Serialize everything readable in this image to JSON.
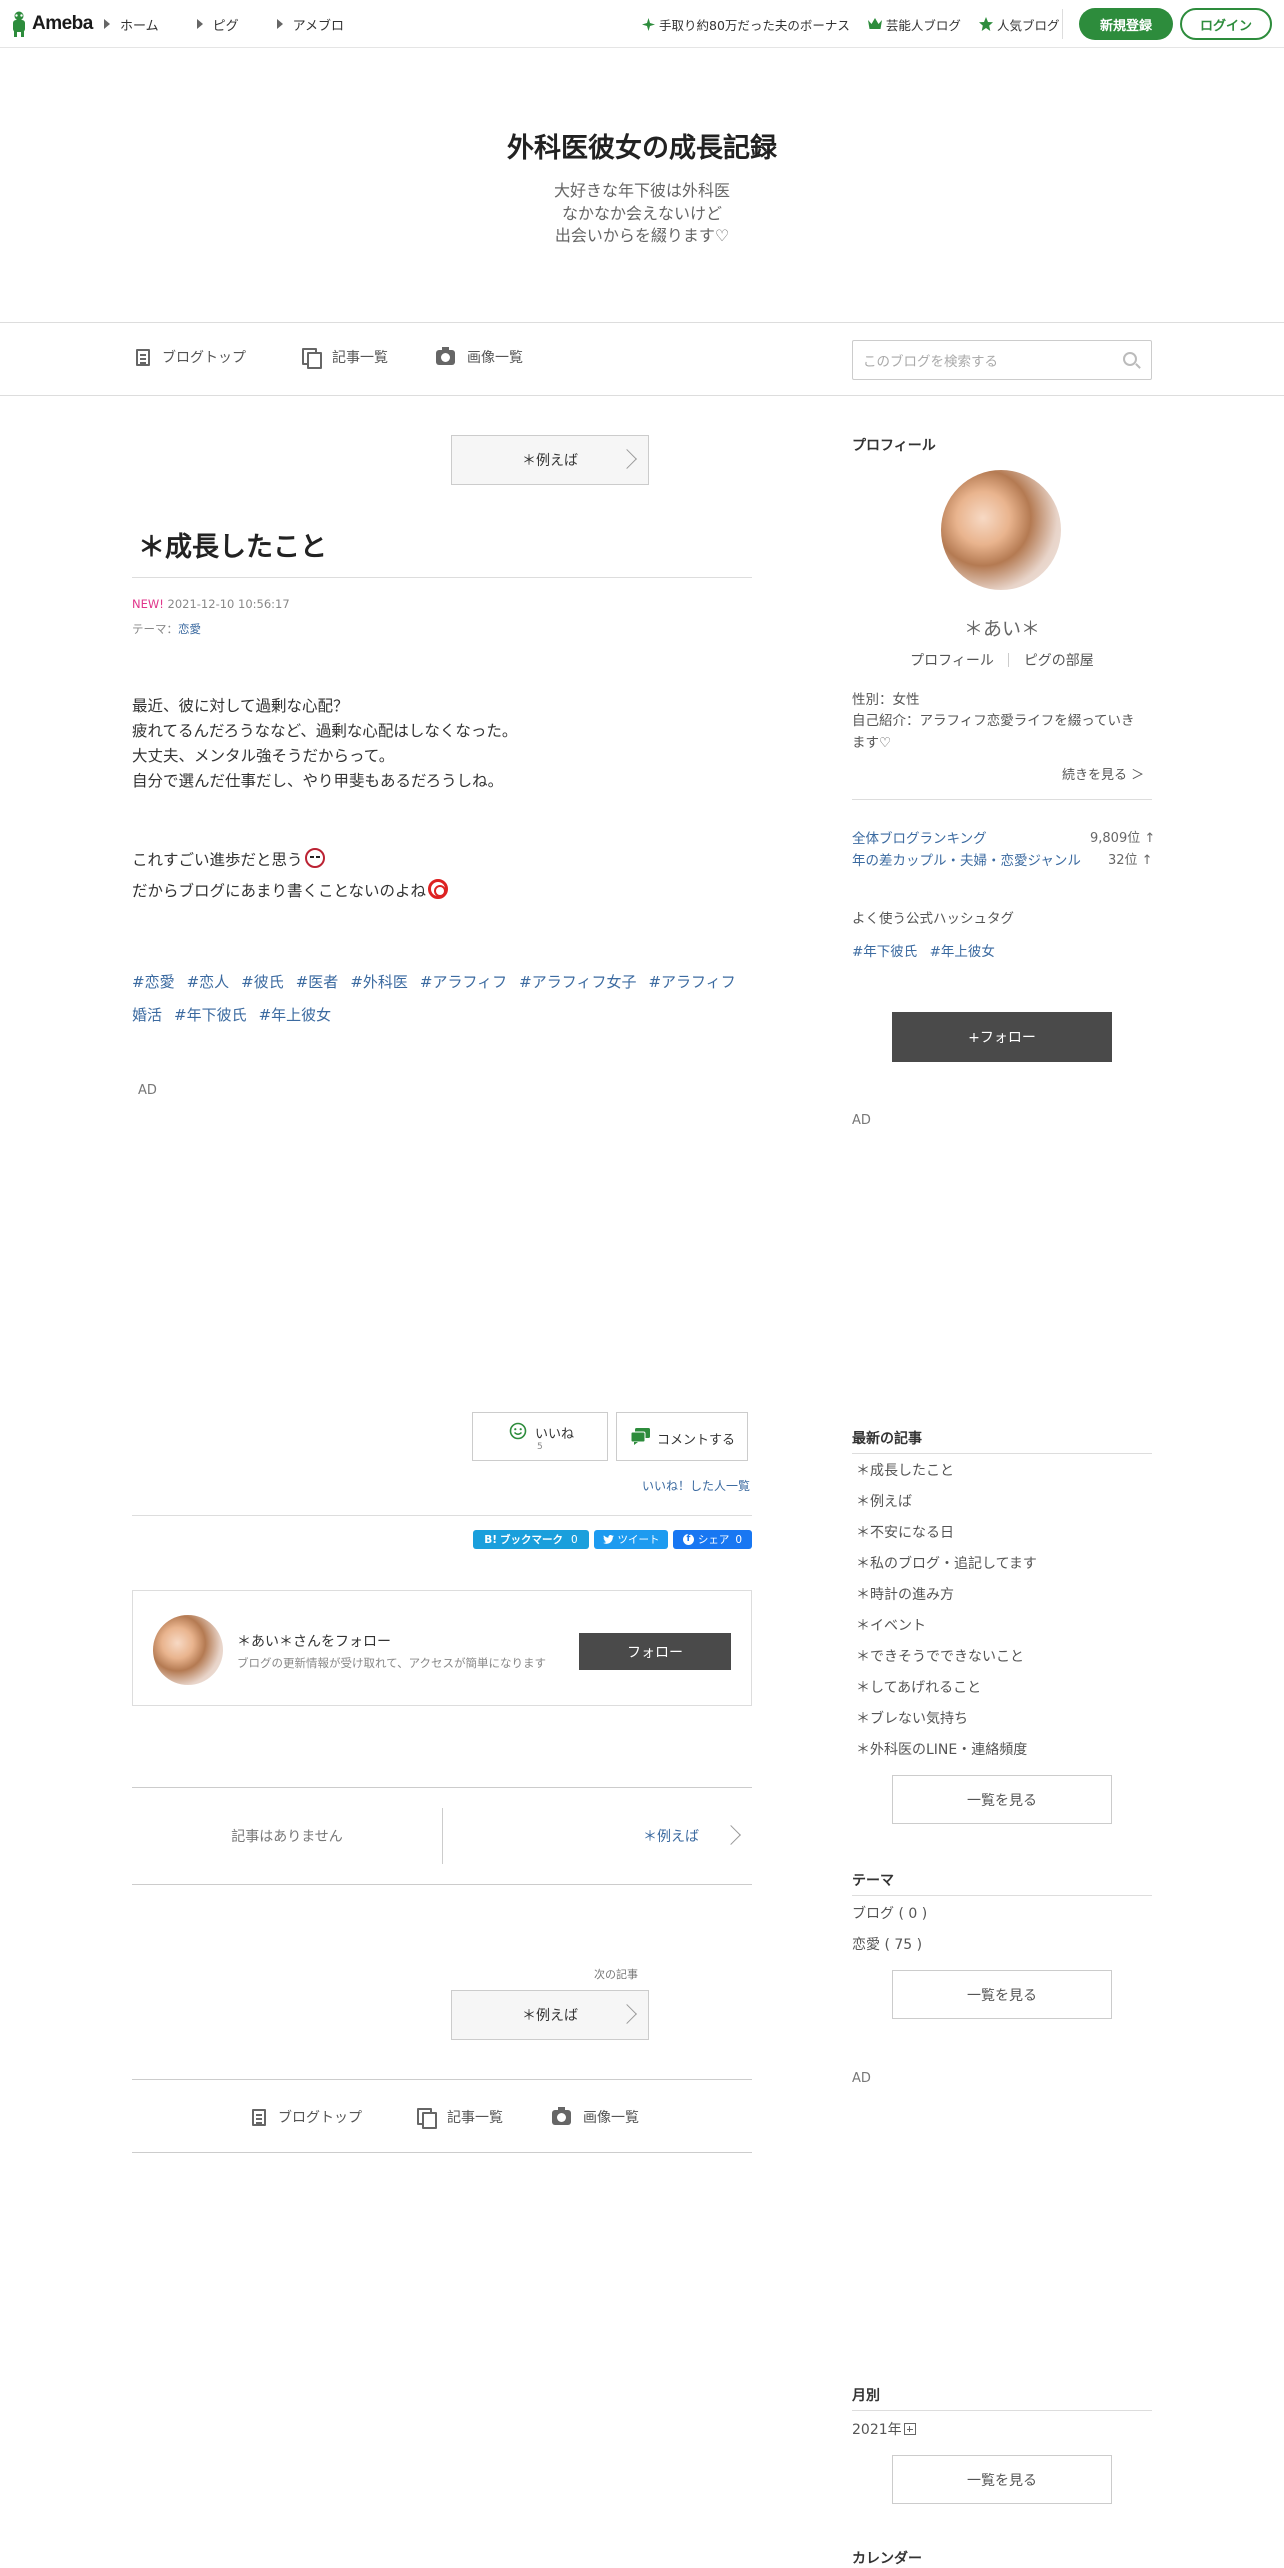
{
  "header": {
    "logo_text": "Ameba",
    "nav": [
      "ホーム",
      "ピグ",
      "アメブロ"
    ],
    "promo": "手取り約80万だった夫のボーナス",
    "celeb": "芸能人ブログ",
    "popular": "人気ブログ",
    "signup": "新規登録",
    "login": "ログイン",
    "brand_color": "#2d8c3c"
  },
  "blog": {
    "title": "外科医彼女の成長記録",
    "description": [
      "大好きな年下彼は外科医",
      "なかなか会えないけど",
      "出会いからを綴ります♡"
    ]
  },
  "blognav": {
    "top": "ブログトップ",
    "list": "記事一覧",
    "images": "画像一覧",
    "search_placeholder": "このブログを検索する"
  },
  "entry": {
    "prev_top": "＊例えば",
    "title": "＊成長したこと",
    "new_badge": "NEW!",
    "date": "2021-12-10 10:56:17",
    "theme_label": "テーマ：",
    "theme": "恋愛",
    "paragraph1": [
      "最近、彼に対して過剰な心配？",
      "疲れてるんだろうななど、過剰な心配はしなくなった。",
      "大丈夫、メンタル強そうだからって。",
      "自分で選んだ仕事だし、やり甲斐もあるだろうしね。"
    ],
    "paragraph2_line1": "これすごい進歩だと思う",
    "paragraph2_line2": "だからブログにあまり書くことないのよね",
    "tags_line1": [
      "#恋愛",
      "#恋人",
      "#彼氏",
      "#医者",
      "#外科医",
      "#アラフィフ",
      "#アラフィフ女子",
      "#アラフィフ"
    ],
    "tags_line2": [
      "婚活",
      "#年下彼氏",
      "#年上彼女"
    ],
    "ad": "AD",
    "like_label": "いいね",
    "like_count": "5",
    "comment_label": "コメントする",
    "liked_people": "いいね！した人一覧",
    "hatena": "ブックマーク",
    "hatena_count": "0",
    "tweet": "ツイート",
    "share": "シェア",
    "share_count": "0",
    "follow_title": "＊あい＊さんをフォロー",
    "follow_desc": "ブログの更新情報が受け取れて、アクセスが簡単になります",
    "follow_button": "フォロー",
    "prev_none": "記事はありません",
    "next_link": "＊例えば",
    "next_label": "次の記事",
    "next_button": "＊例えば",
    "footer_top": "ブログトップ",
    "footer_list": "記事一覧",
    "footer_images": "画像一覧"
  },
  "sidebar": {
    "profile_heading": "プロフィール",
    "name": "＊あい＊",
    "profile_link": "プロフィール",
    "pig_link": "ピグの部屋",
    "gender": "性別：女性",
    "intro": [
      "自己紹介：アラフィフ恋愛ライフを綴っていき",
      "ます♡"
    ],
    "more": "続きを見る ＞",
    "rank1_label": "全体ブログランキング",
    "rank1_value": "9,809位 ↑",
    "rank2_label": "年の差カップル・夫婦・恋愛ジャンル",
    "rank2_value": "32位 ↑",
    "hashtag_heading": "よく使う公式ハッシュタグ",
    "hashtags": [
      "#年下彼氏",
      "#年上彼女"
    ],
    "follow": "+フォロー",
    "ad": "AD",
    "recent_heading": "最新の記事",
    "recent": [
      "＊成長したこと",
      "＊例えば",
      "＊不安になる日",
      "＊私のブログ・追記してます",
      "＊時計の進み方",
      "＊イベント",
      "＊できそうでできないこと",
      "＊してあげれること",
      "＊ブレない気持ち",
      "＊外科医のLINE・連絡頻度"
    ],
    "see_all": "一覧を見る",
    "theme_heading": "テーマ",
    "themes": [
      "ブログ ( 0 )",
      "恋愛 ( 75 )"
    ],
    "ad2": "AD",
    "monthly_heading": "月別",
    "year": "2021年",
    "calendar_heading": "カレンダー"
  }
}
